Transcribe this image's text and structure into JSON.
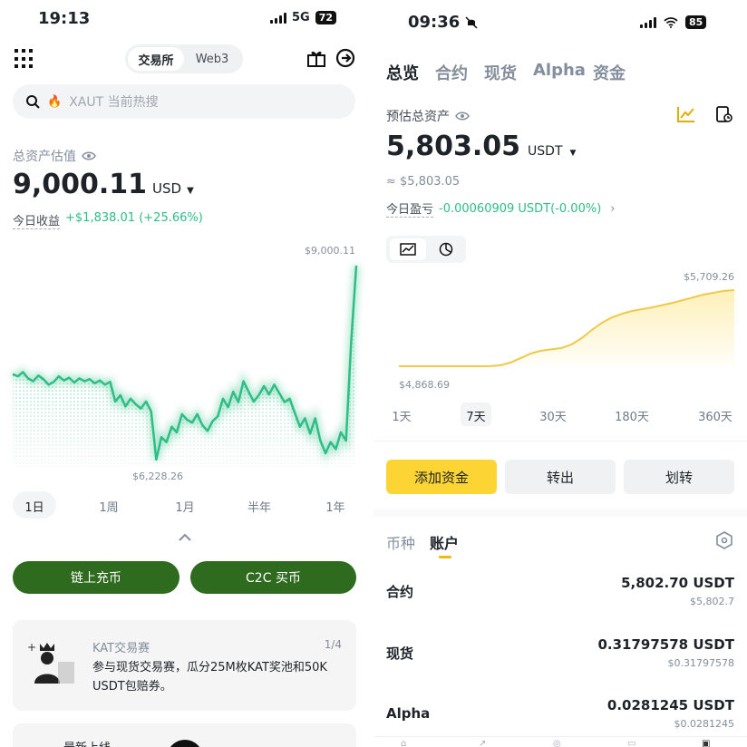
{
  "left": {
    "status": {
      "time": "19:13",
      "network": "5G",
      "battery": "72"
    },
    "header": {
      "segment_exchange": "交易所",
      "segment_web3": "Web3"
    },
    "search": {
      "placeholder": "XAUT 当前热搜"
    },
    "assets": {
      "label": "总资产估值",
      "value": "9,000.11",
      "currency": "USD",
      "today_label": "今日收益",
      "today_value": "+$1,838.01 (+25.66%)"
    },
    "chart_data": {
      "type": "line",
      "max_label": "$9,000.11",
      "min_label": "$6,228.26",
      "values": [
        7450,
        7420,
        7480,
        7390,
        7350,
        7430,
        7380,
        7300,
        7340,
        7420,
        7360,
        7400,
        7330,
        7390,
        7350,
        7380,
        7320,
        7360,
        7300,
        7340,
        7060,
        7150,
        6990,
        7100,
        7020,
        6960,
        7060,
        6920,
        6230,
        6550,
        6480,
        6700,
        6620,
        6880,
        6800,
        6760,
        6880,
        6720,
        6640,
        6780,
        6850,
        7100,
        6980,
        7200,
        7050,
        7350,
        7200,
        7060,
        7150,
        7280,
        7160,
        7300,
        7180,
        7050,
        7100,
        6900,
        6700,
        6820,
        6600,
        6820,
        6500,
        6320,
        6480,
        6380,
        6620,
        6500,
        7900,
        9000
      ],
      "line_color": "#2ebd85"
    },
    "ranges": [
      "1日",
      "1周",
      "1月",
      "半年",
      "1年"
    ],
    "buttons": {
      "onchain": "链上充币",
      "c2c": "C2C 买币"
    },
    "promo": {
      "title": "KAT交易赛",
      "page": "1/4",
      "body": "参与现货交易赛，瓜分25M枚KAT奖池和50K USDT包赔券。"
    },
    "next_card": {
      "title": "最新上线"
    }
  },
  "right": {
    "status": {
      "time": "09:36",
      "battery": "85"
    },
    "tabs": [
      "总览",
      "合约",
      "现货",
      "Alpha",
      "资金"
    ],
    "assets": {
      "label": "预估总资产",
      "value": "5,803.05",
      "currency": "USDT",
      "approx": "≈ $5,803.05",
      "pnl_label": "今日盈亏",
      "pnl_value": "-0.00060909 USDT(-0.00%)"
    },
    "chart_data": {
      "type": "area",
      "max_label": "$5,709.26",
      "min_label": "$4,868.69",
      "values": [
        4868.69,
        4868.69,
        4868.69,
        4868.69,
        4868.69,
        4868.69,
        4868.69,
        4868.69,
        4868.69,
        4870,
        4880,
        4910,
        4960,
        5010,
        5040,
        5055,
        5070,
        5110,
        5180,
        5270,
        5350,
        5410,
        5450,
        5480,
        5500,
        5520,
        5545,
        5570,
        5600,
        5630,
        5660,
        5680,
        5700,
        5709.26
      ],
      "line_color": "#f0c94b"
    },
    "ranges": [
      "1天",
      "7天",
      "30天",
      "180天",
      "360天"
    ],
    "actions": {
      "add_funds": "添加资金",
      "transfer_out": "转出",
      "transfer": "划转"
    },
    "list_tabs": {
      "coin": "币种",
      "account": "账户"
    },
    "accounts": [
      {
        "name": "合约",
        "value": "5,802.70 USDT",
        "usd": "$5,802.7"
      },
      {
        "name": "现货",
        "value": "0.31797578 USDT",
        "usd": "$0.31797578"
      },
      {
        "name": "Alpha",
        "value": "0.0281245 USDT",
        "usd": "$0.0281245"
      }
    ]
  }
}
